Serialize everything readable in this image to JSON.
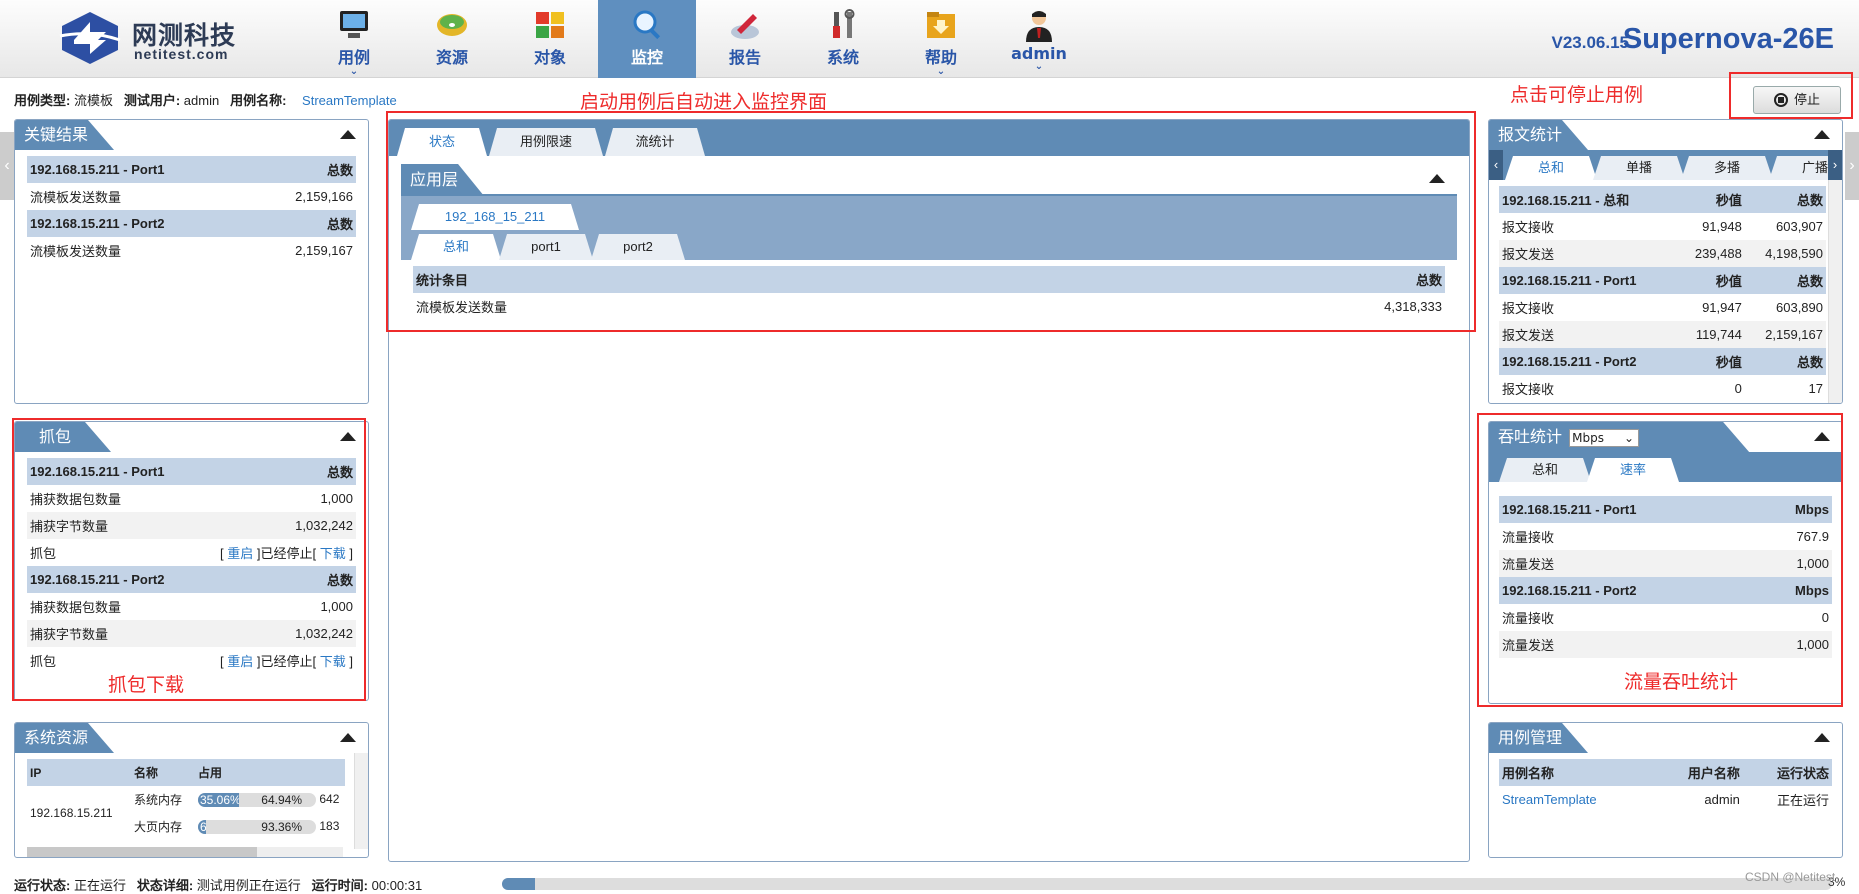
{
  "header": {
    "logo_cn": "网测科技",
    "logo_en": "netitest.com",
    "version": "V23.06.15",
    "product": "Supernova-26E",
    "nav": [
      {
        "label": "用例",
        "icon": "monitor-icon",
        "chevron": "⌄"
      },
      {
        "label": "资源",
        "icon": "disc-icon"
      },
      {
        "label": "对象",
        "icon": "blocks-icon"
      },
      {
        "label": "监控",
        "icon": "magnifier-icon",
        "active": true
      },
      {
        "label": "报告",
        "icon": "report-icon"
      },
      {
        "label": "系统",
        "icon": "tools-icon"
      },
      {
        "label": "帮助",
        "icon": "folder-icon",
        "chevron": "⌄"
      },
      {
        "label": "admin",
        "icon": "user-icon",
        "chevron": "⌄"
      }
    ]
  },
  "info": {
    "type_label": "用例类型:",
    "type_value": "流模板",
    "user_label": "测试用户:",
    "user_value": "admin",
    "name_label": "用例名称:",
    "name_value": "StreamTemplate"
  },
  "stop_button": "停止",
  "annotations": {
    "monitor": "启动用例后自动进入监控界面",
    "stop": "点击可停止用例",
    "capture": "抓包下载",
    "throughput": "流量吞吐统计"
  },
  "key_results": {
    "title": "关键结果",
    "groups": [
      {
        "header": "192.168.15.211 - Port1",
        "col": "总数",
        "rows": [
          {
            "label": "流模板发送数量",
            "value": "2,159,166"
          }
        ]
      },
      {
        "header": "192.168.15.211 - Port2",
        "col": "总数",
        "rows": [
          {
            "label": "流模板发送数量",
            "value": "2,159,167"
          }
        ]
      }
    ]
  },
  "capture": {
    "title": "抓包",
    "groups": [
      {
        "header": "192.168.15.211 - Port1",
        "col": "总数",
        "pkt_label": "捕获数据包数量",
        "pkt": "1,000",
        "bytes_label": "捕获字节数量",
        "bytes": "1,032,242",
        "cap_label": "抓包",
        "restart": "重启",
        "stopped": "]已经停止[",
        "download": "下载"
      },
      {
        "header": "192.168.15.211 - Port2",
        "col": "总数",
        "pkt_label": "捕获数据包数量",
        "pkt": "1,000",
        "bytes_label": "捕获字节数量",
        "bytes": "1,032,242",
        "cap_label": "抓包",
        "restart": "重启",
        "stopped": "]已经停止[",
        "download": "下载"
      }
    ]
  },
  "sysres": {
    "title": "系统资源",
    "cols": [
      "IP",
      "名称",
      "占用"
    ],
    "ip": "192.168.15.211",
    "rows": [
      {
        "name": "系统内存",
        "used": "35.06%",
        "free": "64.94%",
        "used_frac": 0.3506,
        "extra": "642"
      },
      {
        "name": "大页内存",
        "used": "6.64%",
        "free": "93.36%",
        "used_frac": 0.0664,
        "extra": "183"
      }
    ]
  },
  "main": {
    "tabs": [
      "状态",
      "用例限速",
      "流统计"
    ],
    "section": "应用层",
    "host_tab": "192_168_15_211",
    "sub_tabs": [
      "总和",
      "port1",
      "port2"
    ],
    "cols": [
      "统计条目",
      "总数"
    ],
    "rows": [
      {
        "label": "流模板发送数量",
        "value": "4,318,333"
      }
    ]
  },
  "pkt_stats": {
    "title": "报文统计",
    "tabs": [
      "总和",
      "单播",
      "多播",
      "广播"
    ],
    "groups": [
      {
        "header": "192.168.15.211 - 总和",
        "c1": "秒值",
        "c2": "总数",
        "rows": [
          {
            "label": "报文接收",
            "v1": "91,948",
            "v2": "603,907"
          },
          {
            "label": "报文发送",
            "v1": "239,488",
            "v2": "4,198,590"
          }
        ]
      },
      {
        "header": "192.168.15.211 - Port1",
        "c1": "秒值",
        "c2": "总数",
        "rows": [
          {
            "label": "报文接收",
            "v1": "91,947",
            "v2": "603,890"
          },
          {
            "label": "报文发送",
            "v1": "119,744",
            "v2": "2,159,167"
          }
        ]
      },
      {
        "header": "192.168.15.211 - Port2",
        "c1": "秒值",
        "c2": "总数",
        "rows": [
          {
            "label": "报文接收",
            "v1": "0",
            "v2": "17"
          }
        ]
      }
    ]
  },
  "throughput": {
    "title": "吞吐统计",
    "unit_select": "Mbps",
    "tabs": [
      "总和",
      "速率"
    ],
    "groups": [
      {
        "header": "192.168.15.211 - Port1",
        "col": "Mbps",
        "rows": [
          {
            "label": "流量接收",
            "value": "767.9"
          },
          {
            "label": "流量发送",
            "value": "1,000"
          }
        ]
      },
      {
        "header": "192.168.15.211 - Port2",
        "col": "Mbps",
        "rows": [
          {
            "label": "流量接收",
            "value": "0"
          },
          {
            "label": "流量发送",
            "value": "1,000"
          }
        ]
      }
    ]
  },
  "case_mgmt": {
    "title": "用例管理",
    "cols": [
      "用例名称",
      "用户名称",
      "运行状态"
    ],
    "rows": [
      {
        "name": "StreamTemplate",
        "user": "admin",
        "status": "正在运行"
      }
    ]
  },
  "footer": {
    "run_label": "运行状态:",
    "run_value": "正在运行",
    "detail_label": "状态详细:",
    "detail_value": "测试用例正在运行",
    "time_label": "运行时间:",
    "time_value": "00:00:31",
    "progress": "3%",
    "progress_frac": 0.025,
    "watermark": "CSDN @Netitest"
  }
}
